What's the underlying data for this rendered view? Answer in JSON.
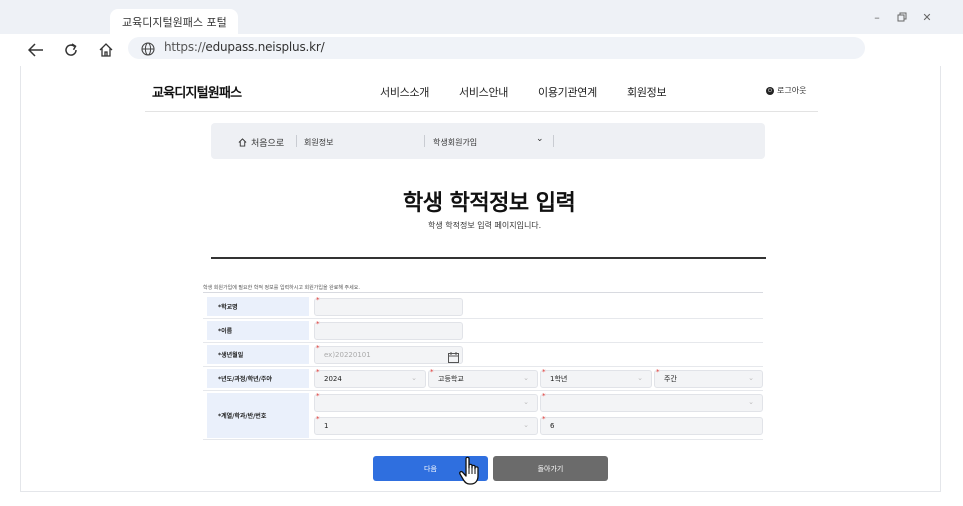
{
  "browser": {
    "tab_title": "교육디지털원패스 포털",
    "url_proto": "https://",
    "url_host": "edupass.neisplus.kr/"
  },
  "header": {
    "logo": "교육디지털원패스",
    "nav": [
      "서비스소개",
      "서비스안내",
      "이용기관연계",
      "회원정보"
    ],
    "logout": "로그아웃"
  },
  "breadcrumb": {
    "home": "처음으로",
    "level1": "회원정보",
    "level2": "학생회원가입"
  },
  "page": {
    "title": "학생 학적정보 입력",
    "subtitle": "학생 학적정보 입력 페이지입니다."
  },
  "form": {
    "guide": "학생 회원가입에 필요한 학적 정보를 입력하시고 회원가입을 완료해 주세요.",
    "labels": {
      "school": "*학교명",
      "name": "*이름",
      "birth": "*생년월일",
      "year_course": "*년도/과정/학년/주야",
      "dept": "*계열/학과/반/번호"
    },
    "birth_placeholder": "ex)20220101",
    "year": "2024",
    "course": "고등학교",
    "grade": "1학년",
    "daynight": "주간",
    "class_no": "1",
    "student_no": "6"
  },
  "buttons": {
    "next": "다음",
    "back": "돌아가기"
  }
}
